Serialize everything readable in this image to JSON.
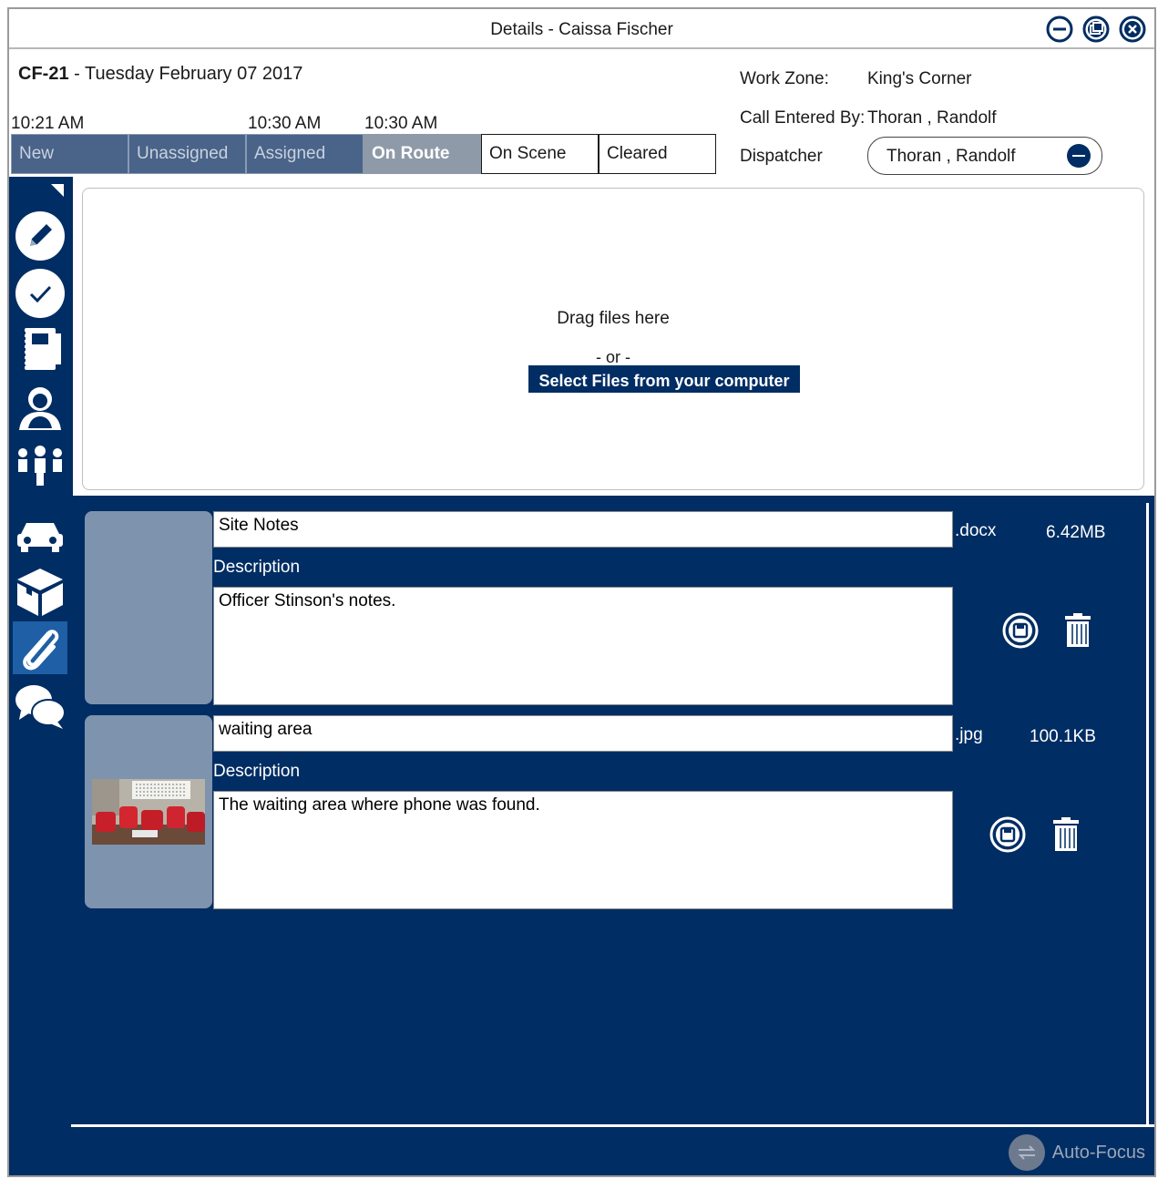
{
  "window": {
    "title": "Details - Caissa Fischer"
  },
  "call": {
    "id": "CF-21",
    "separator": " - ",
    "date": "Tuesday February 07 2017"
  },
  "times": [
    "10:21 AM",
    "10:30 AM",
    "10:30 AM"
  ],
  "statuses": [
    {
      "label": "New",
      "state": "done"
    },
    {
      "label": "Unassigned",
      "state": "done"
    },
    {
      "label": "Assigned",
      "state": "done"
    },
    {
      "label": "On Route",
      "state": "active"
    },
    {
      "label": "On Scene",
      "state": "todo"
    },
    {
      "label": "Cleared",
      "state": "todo"
    }
  ],
  "info": {
    "work_zone_label": "Work Zone:",
    "work_zone_value": "King's Corner",
    "entered_by_label": "Call Entered By:",
    "entered_by_value": "Thoran , Randolf",
    "dispatcher_label": "Dispatcher",
    "dispatcher_value": "Thoran , Randolf"
  },
  "upload": {
    "drag_text": "Drag files here",
    "or_text": "- or -",
    "select_label": "Select Files from your computer"
  },
  "files": [
    {
      "name": "Site Notes",
      "description_label": "Description",
      "description": "Officer Stinson's notes.",
      "ext": ".docx",
      "size": "6.42MB"
    },
    {
      "name": "waiting area",
      "description_label": "Description",
      "description": "The waiting area where phone was found.",
      "ext": ".jpg",
      "size": "100.1KB"
    }
  ],
  "footer": {
    "autofocus_label": "Auto-Focus"
  },
  "colors": {
    "navy": "#002d63",
    "status_done": "#4a6388",
    "status_active": "#8f9aa8",
    "sidebar_selected": "#1e5fa6"
  }
}
